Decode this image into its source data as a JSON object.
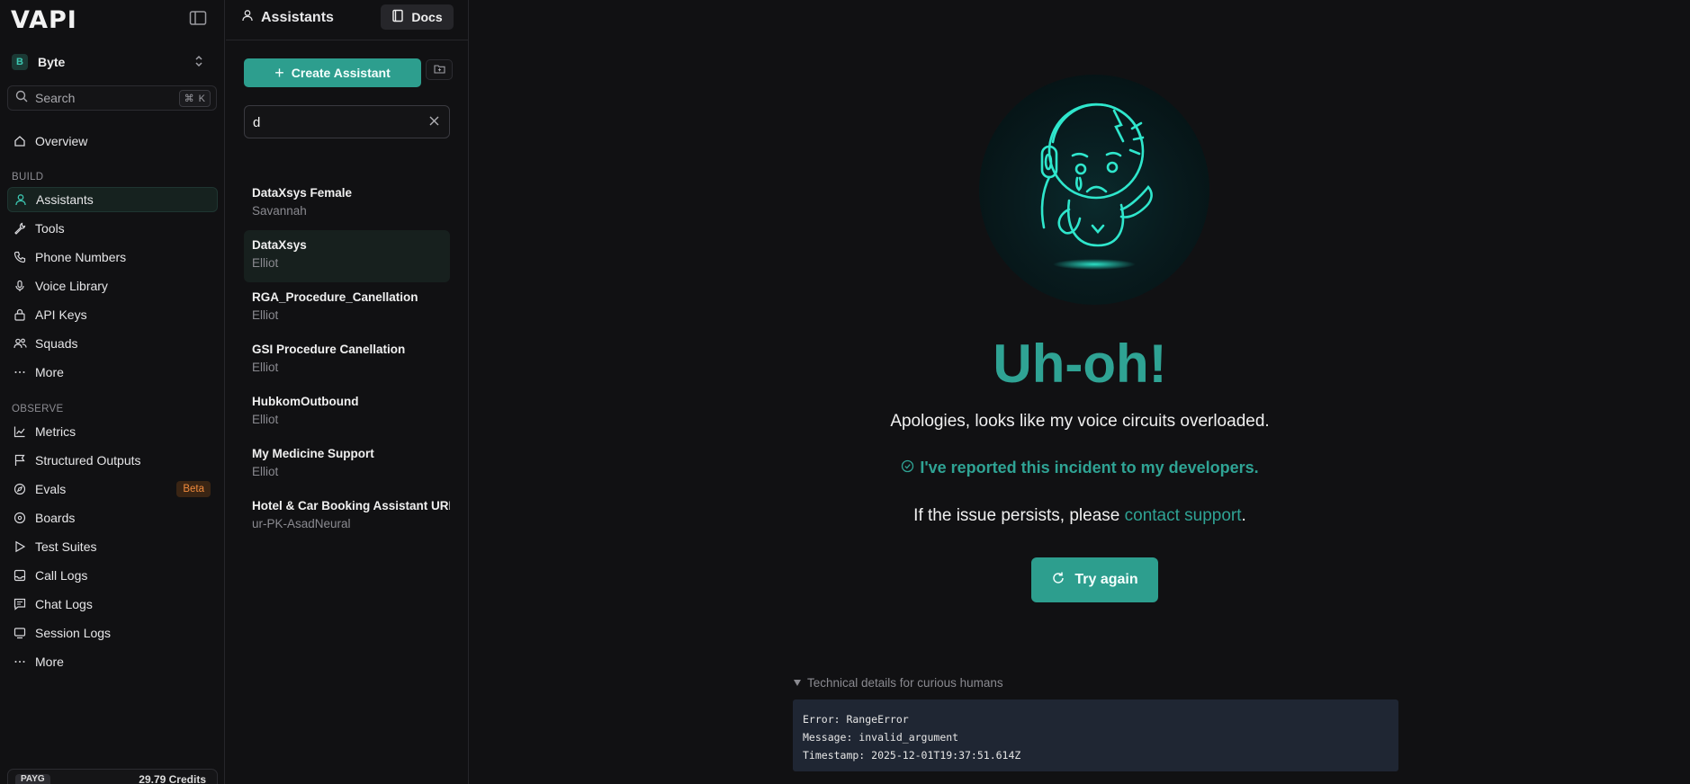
{
  "app": {
    "logo_text": "VAPI"
  },
  "sidebar": {
    "org": {
      "initial": "B",
      "name": "Byte"
    },
    "search": {
      "label": "Search",
      "shortcut_symbol": "⌘",
      "shortcut_key": "K"
    },
    "overview": "Overview",
    "build_section": "BUILD",
    "build_items": [
      {
        "label": "Assistants",
        "icon": "user-icon"
      },
      {
        "label": "Tools",
        "icon": "wrench-icon"
      },
      {
        "label": "Phone Numbers",
        "icon": "phone-icon"
      },
      {
        "label": "Voice Library",
        "icon": "microphone-icon"
      },
      {
        "label": "API Keys",
        "icon": "lock-icon"
      },
      {
        "label": "Squads",
        "icon": "users-icon"
      },
      {
        "label": "More",
        "icon": "more-icon"
      }
    ],
    "observe_section": "OBSERVE",
    "observe_items": [
      {
        "label": "Metrics",
        "icon": "chart-icon"
      },
      {
        "label": "Structured Outputs",
        "icon": "flag-icon"
      },
      {
        "label": "Evals",
        "icon": "compass-icon",
        "badge": "Beta"
      },
      {
        "label": "Boards",
        "icon": "palette-icon"
      },
      {
        "label": "Test Suites",
        "icon": "play-icon"
      },
      {
        "label": "Call Logs",
        "icon": "inbox-icon"
      },
      {
        "label": "Chat Logs",
        "icon": "message-icon"
      },
      {
        "label": "Session Logs",
        "icon": "session-icon"
      },
      {
        "label": "More",
        "icon": "more-icon"
      }
    ],
    "plan": {
      "tag": "PAYG",
      "credits": "29.79 Credits"
    }
  },
  "assistants_panel": {
    "title": "Assistants",
    "docs_label": "Docs",
    "create_label": "Create Assistant",
    "filter_value": "d",
    "items": [
      {
        "name": "DataXsys Female",
        "voice": "Savannah"
      },
      {
        "name": "DataXsys",
        "voice": "Elliot"
      },
      {
        "name": "RGA_Procedure_Canellation",
        "voice": "Elliot"
      },
      {
        "name": "GSI Procedure Canellation",
        "voice": "Elliot"
      },
      {
        "name": "HubkomOutbound",
        "voice": "Elliot"
      },
      {
        "name": "My Medicine Support",
        "voice": "Elliot"
      },
      {
        "name": "Hotel & Car Booking Assistant URDU",
        "voice": "ur-PK-AsadNeural"
      }
    ]
  },
  "error": {
    "title": "Uh-oh!",
    "message": "Apologies, looks like my voice circuits overloaded.",
    "reported": "I've reported this incident to my developers.",
    "persist_prefix": "If the issue persists, please ",
    "persist_link": "contact support",
    "persist_suffix": ".",
    "retry_label": "Try again",
    "details_toggle": "Technical details for curious humans",
    "details_lines": [
      "Error: RangeError",
      "Message: invalid_argument",
      "Timestamp: 2025-12-01T19:37:51.614Z"
    ]
  },
  "colors": {
    "accent": "#2d9e8e",
    "accent_text": "#2fa394",
    "background": "#111113",
    "beta": "#f08a3c"
  }
}
